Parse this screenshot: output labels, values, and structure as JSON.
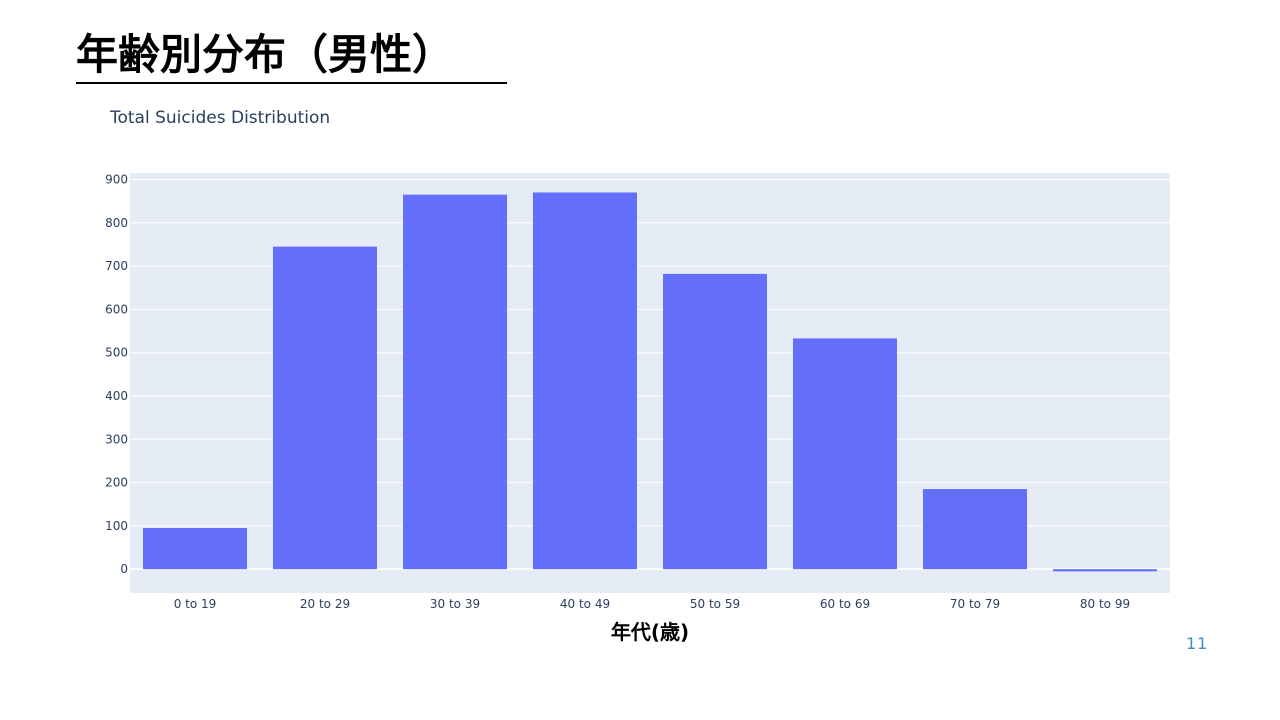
{
  "slide": {
    "title": "年齢別分布（男性）",
    "page_number": "11"
  },
  "colors": {
    "bar": "#636efa",
    "plot_background": "#e5ecf6",
    "gridline": "#ffffff",
    "text": "#2a3f5f"
  },
  "chart_data": {
    "type": "bar",
    "title": "Total Suicides Distribution",
    "xlabel": "年代(歳)",
    "ylabel": "",
    "categories": [
      "0 to 19",
      "20 to 29",
      "30 to 39",
      "40 to 49",
      "50 to 59",
      "60 to 69",
      "70 to 79",
      "80 to 99"
    ],
    "values": [
      95,
      745,
      865,
      870,
      682,
      533,
      185,
      -5
    ],
    "ylim": [
      -55,
      915
    ],
    "yticks": [
      0,
      100,
      200,
      300,
      400,
      500,
      600,
      700,
      800,
      900
    ],
    "grid": true,
    "legend": "none"
  }
}
